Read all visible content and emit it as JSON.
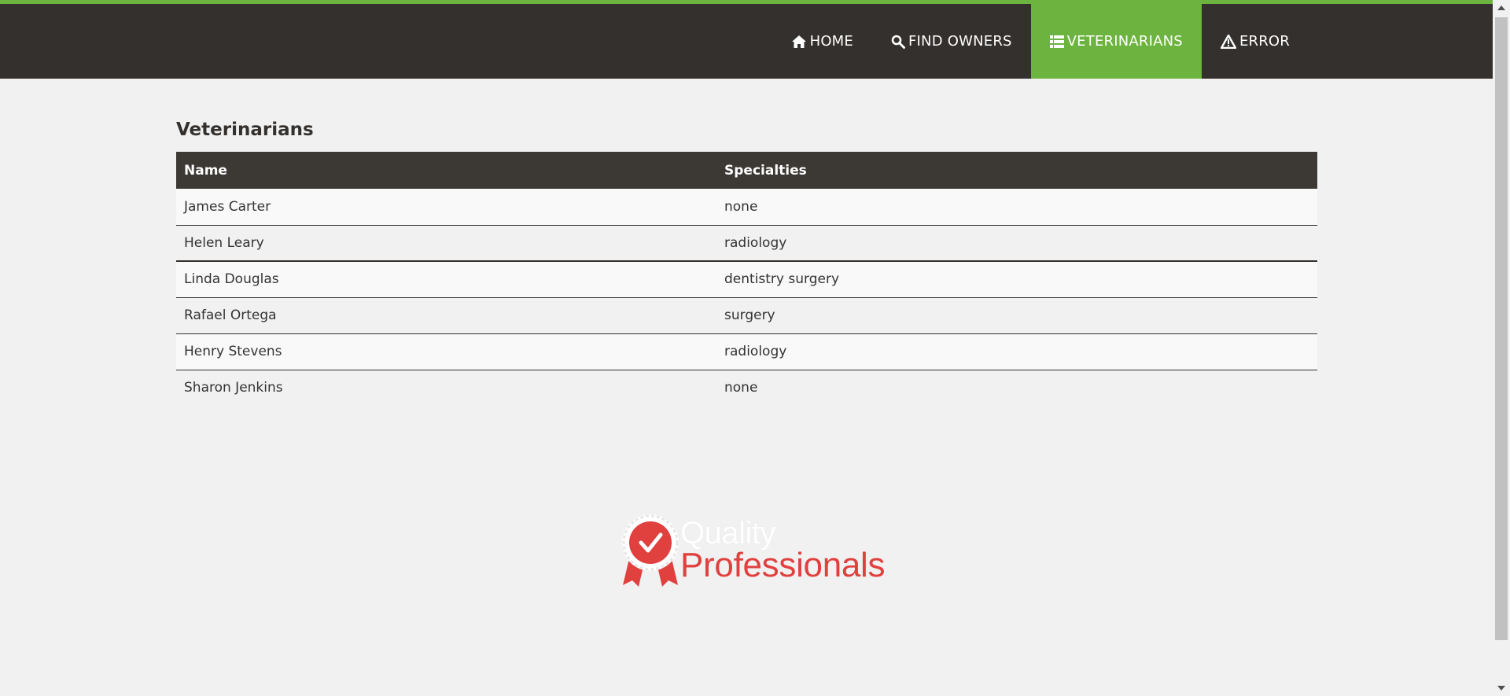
{
  "colors": {
    "brand_green": "#6db33f",
    "nav_dark": "#34302d",
    "logo_red": "#e0403e"
  },
  "nav": {
    "items": [
      {
        "label": "HOME",
        "icon": "home-icon",
        "active": false
      },
      {
        "label": "FIND OWNERS",
        "icon": "search-icon",
        "active": false
      },
      {
        "label": "VETERINARIANS",
        "icon": "list-icon",
        "active": true
      },
      {
        "label": "ERROR",
        "icon": "warning-icon",
        "active": false
      }
    ]
  },
  "page": {
    "title": "Veterinarians"
  },
  "table": {
    "headers": [
      "Name",
      "Specialties"
    ],
    "rows": [
      [
        "James Carter",
        "none"
      ],
      [
        "Helen Leary",
        "radiology"
      ],
      [
        "Linda Douglas",
        "dentistry surgery"
      ],
      [
        "Rafael Ortega",
        "surgery"
      ],
      [
        "Henry Stevens",
        "radiology"
      ],
      [
        "Sharon Jenkins",
        "none"
      ]
    ]
  },
  "logo": {
    "line1": "Quality",
    "line2": "Professionals",
    "icon": "award-ribbon-check-icon"
  }
}
